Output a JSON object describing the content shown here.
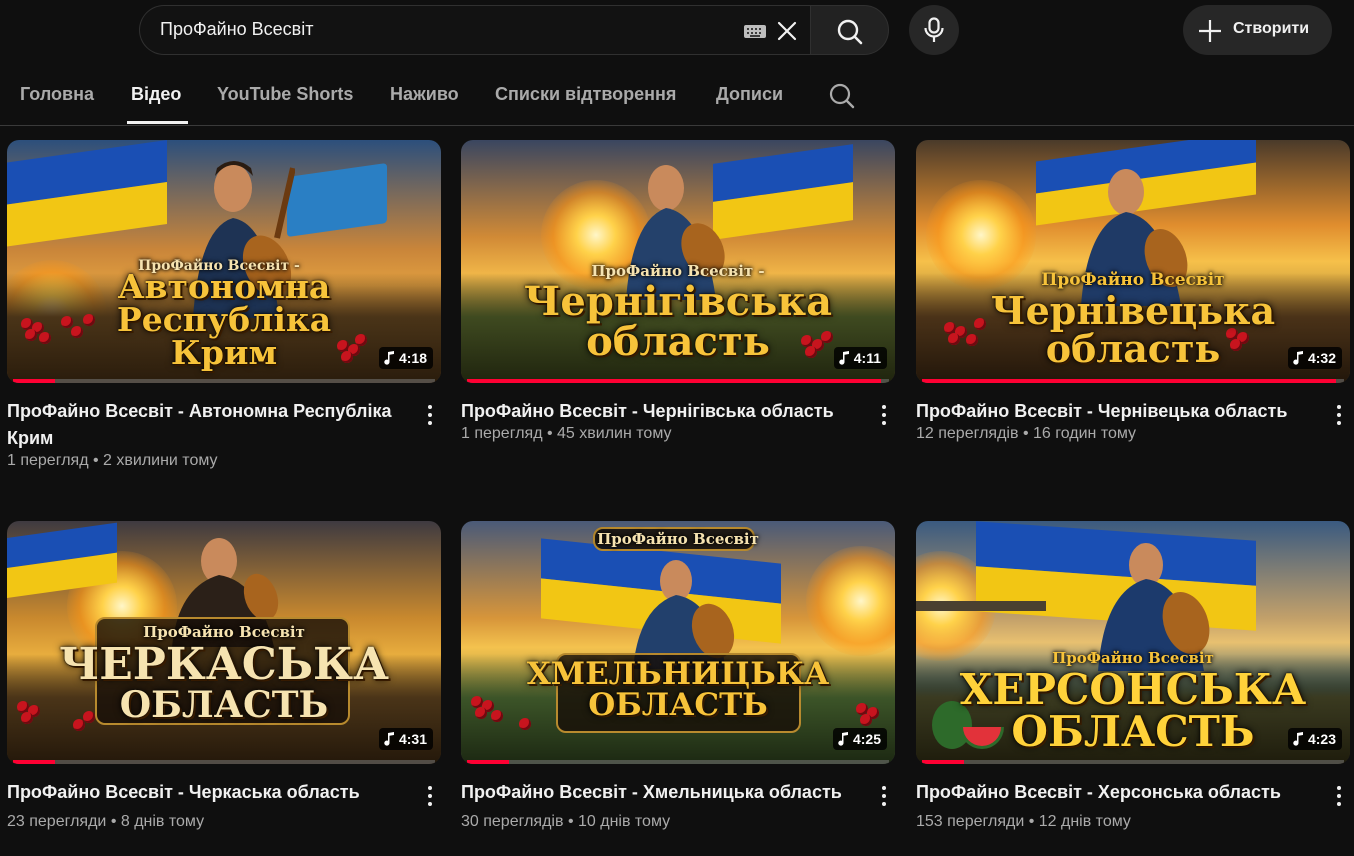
{
  "search": {
    "value": "ПроФайно Всесвіт"
  },
  "header": {
    "create_label": "Створити"
  },
  "tabs": [
    {
      "label": "Головна"
    },
    {
      "label": "Відео"
    },
    {
      "label": "YouTube Shorts"
    },
    {
      "label": "Наживо"
    },
    {
      "label": "Списки відтворення"
    },
    {
      "label": "Дописи"
    }
  ],
  "active_tab": "Відео",
  "videos": [
    {
      "title": "ПроФайно Всесвіт - Автономна Республіка Крим",
      "views": "1 перегляд",
      "age": "2 хвилини тому",
      "duration": "4:18",
      "progress": 0.1,
      "thumb_brand": "ПроФайно Всесвіт -",
      "thumb_title_1": "Автономна",
      "thumb_title_2": "Республіка",
      "thumb_title_3": "Крим"
    },
    {
      "title": "ПроФайно Всесвіт - Чернігівська область",
      "views": "1 перегляд",
      "age": "45 хвилин тому",
      "duration": "4:11",
      "progress": 0.98,
      "thumb_brand": "ПроФайно Всесвіт -",
      "thumb_title_1": "Чернігівська",
      "thumb_title_2": "область",
      "thumb_title_3": ""
    },
    {
      "title": "ПроФайно Всесвіт - Чернівецька область",
      "views": "12 переглядів",
      "age": "16 годин тому",
      "duration": "4:32",
      "progress": 0.98,
      "thumb_brand": "ПроФайно Всесвіт",
      "thumb_title_1": "Чернівецька",
      "thumb_title_2": "область",
      "thumb_title_3": ""
    },
    {
      "title": "ПроФайно Всесвіт - Черкаська область",
      "views": "23 перегляди",
      "age": "8 днів тому",
      "duration": "4:31",
      "progress": 0.1,
      "thumb_brand": "ПроФайно Всесвіт",
      "thumb_title_1": "ЧЕРКАСЬКА",
      "thumb_title_2": "ОБЛАСТЬ",
      "thumb_title_3": ""
    },
    {
      "title": "ПроФайно Всесвіт - Хмельницька область",
      "views": "30 переглядів",
      "age": "10 днів тому",
      "duration": "4:25",
      "progress": 0.1,
      "thumb_brand": "ПроФайно Всесвіт",
      "thumb_title_1": "ХМЕЛЬНИЦЬКА",
      "thumb_title_2": "ОБЛАСТЬ",
      "thumb_title_3": ""
    },
    {
      "title": "ПроФайно Всесвіт - Херсонська область",
      "views": "153 перегляди",
      "age": "12 днів тому",
      "duration": "4:23",
      "progress": 0.1,
      "thumb_brand": "ПроФайно Всесвіт",
      "thumb_title_1": "ХЕРСОНСЬКА",
      "thumb_title_2": "ОБЛАСТЬ",
      "thumb_title_3": ""
    }
  ],
  "colors": {
    "background": "#0f0f0f",
    "progress": "#ff0033",
    "flag_blue": "#1a4fb4",
    "flag_yellow": "#f2c614",
    "title_gold": "#f7c33a"
  },
  "icons": [
    "keyboard-icon",
    "clear-icon",
    "search-icon",
    "mic-icon",
    "plus-icon",
    "music-note-icon",
    "more-vert-icon"
  ]
}
